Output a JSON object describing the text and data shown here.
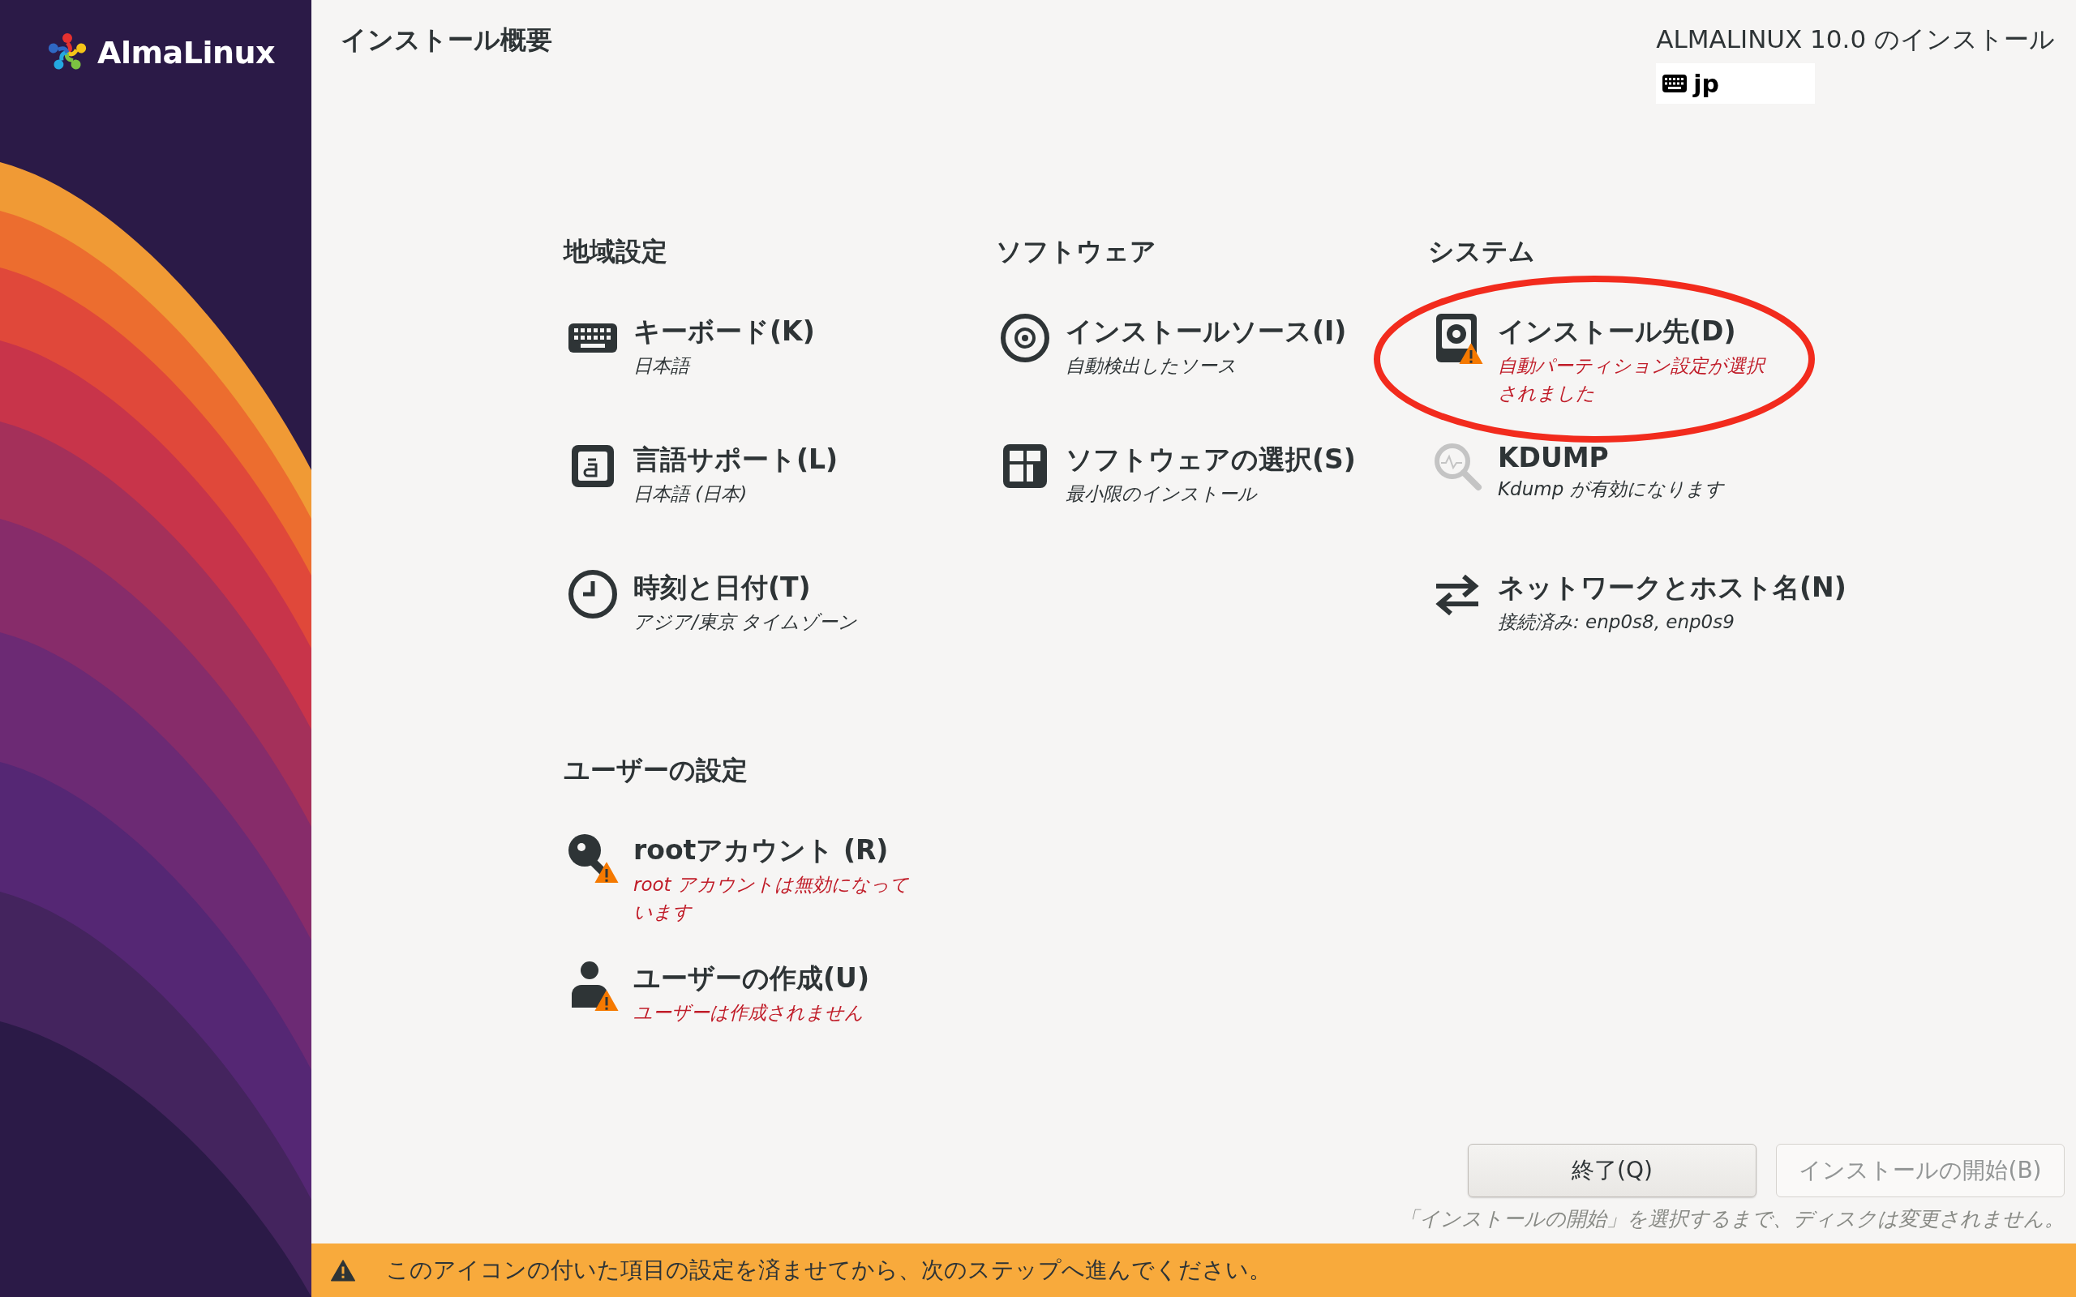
{
  "sidebar": {
    "logo_text": "AlmaLinux"
  },
  "header": {
    "title": "インストール概要",
    "product": "ALMALINUX 10.0 のインストール",
    "keyboard_layout": "jp"
  },
  "categories": [
    {
      "heading": "地域設定",
      "spokes": [
        {
          "kind": "keyboard",
          "title": "キーボード(K)",
          "status": "日本語",
          "warning": false,
          "circled": false,
          "dimmed": false
        },
        {
          "kind": "language",
          "title": "言語サポート(L)",
          "status": "日本語 (日本)",
          "warning": false,
          "circled": false,
          "dimmed": false
        },
        {
          "kind": "clock",
          "title": "時刻と日付(T)",
          "status": "アジア/東京 タイムゾーン",
          "warning": false,
          "circled": false,
          "dimmed": false
        }
      ]
    },
    {
      "heading": "ソフトウェア",
      "spokes": [
        {
          "kind": "disc",
          "title": "インストールソース(I)",
          "status": "自動検出したソース",
          "warning": false,
          "circled": false,
          "dimmed": false
        },
        {
          "kind": "package",
          "title": "ソフトウェアの選択(S)",
          "status": "最小限のインストール",
          "warning": false,
          "circled": false,
          "dimmed": false
        }
      ]
    },
    {
      "heading": "システム",
      "spokes": [
        {
          "kind": "disk",
          "title": "インストール先(D)",
          "status": "自動パーティション設定が選択されました",
          "warning": true,
          "circled": true,
          "dimmed": false
        },
        {
          "kind": "kdump",
          "title": "KDUMP",
          "status": "Kdump が有効になります",
          "warning": false,
          "circled": false,
          "dimmed": true
        },
        {
          "kind": "network",
          "title": "ネットワークとホスト名(N)",
          "status": "接続済み: enp0s8, enp0s9",
          "warning": false,
          "circled": false,
          "dimmed": false
        }
      ]
    },
    {
      "heading": "ユーザーの設定",
      "spokes": [
        {
          "kind": "root",
          "title": "rootアカウント (R)",
          "status": "root アカウントは無効になっています",
          "warning": true,
          "circled": false,
          "dimmed": false
        },
        {
          "kind": "user",
          "title": "ユーザーの作成(U)",
          "status": "ユーザーは作成されません",
          "warning": true,
          "circled": false,
          "dimmed": false
        }
      ]
    }
  ],
  "buttons": [
    {
      "label": "終了(Q)",
      "disabled": false
    },
    {
      "label": "インストールの開始(B)",
      "disabled": true
    }
  ],
  "note": "「インストールの開始」を選択するまで、ディスクは変更されません。",
  "warning_bar": {
    "text": "このアイコンの付いた項目の設定を済ませてから、次のステップへ進んでください。"
  }
}
